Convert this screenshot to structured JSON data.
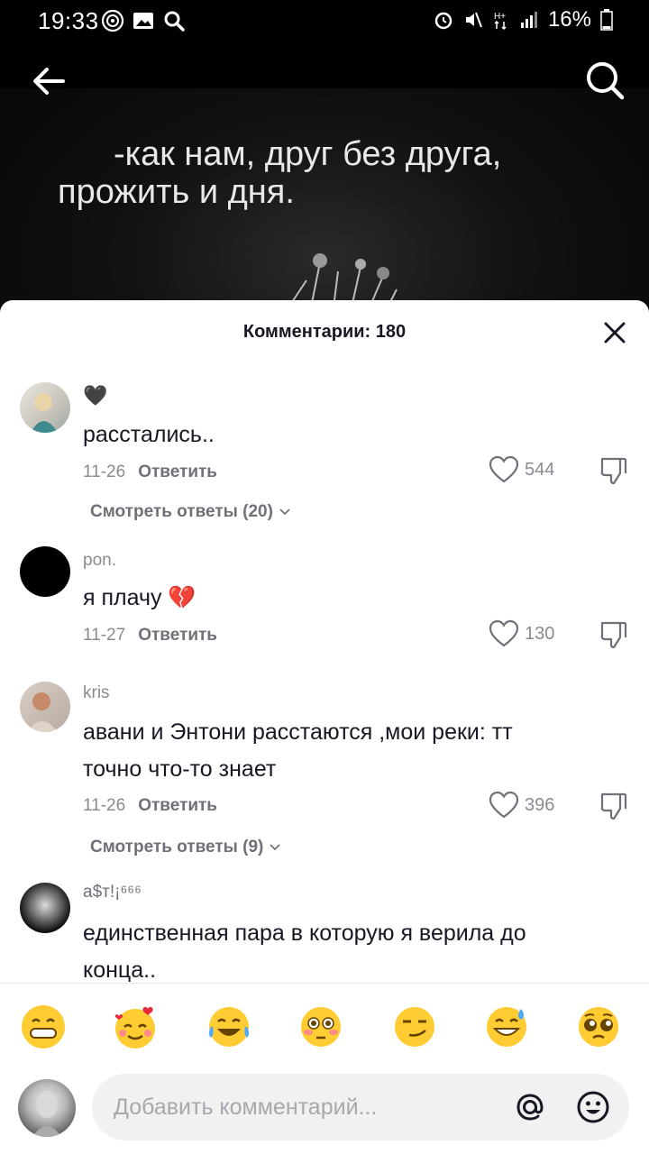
{
  "status_bar": {
    "time": "19:33",
    "battery": "16%"
  },
  "video": {
    "caption_line1": "-как нам, друг без друга,",
    "caption_line2": "прожить и дня."
  },
  "comments_sheet": {
    "title": "Комментарии: 180",
    "comments": [
      {
        "name": "🖤",
        "text": "расстались..",
        "date": "11-26",
        "reply_label": "Ответить",
        "likes": "544",
        "view_replies": "Смотреть ответы (20)"
      },
      {
        "name": "pon.",
        "text": "я плачу 💔",
        "date": "11-27",
        "reply_label": "Ответить",
        "likes": "130"
      },
      {
        "name": "kris",
        "text": "авани и Энтони расстаются ,мои реки: тт точно что-то знает",
        "date": "11-26",
        "reply_label": "Ответить",
        "likes": "396",
        "view_replies": "Смотреть ответы (9)"
      },
      {
        "name": "a$т!¡⁶⁶⁶",
        "text": "единственная пара в которую я верила до конца.."
      }
    ]
  },
  "emoji_bar": [
    "😁",
    "🥰",
    "😂",
    "😳",
    "😏",
    "😅",
    "🥺"
  ],
  "input": {
    "placeholder": "Добавить комментарий..."
  },
  "colors": {
    "accent_text": "#161823",
    "secondary_text": "#8a8b91"
  }
}
